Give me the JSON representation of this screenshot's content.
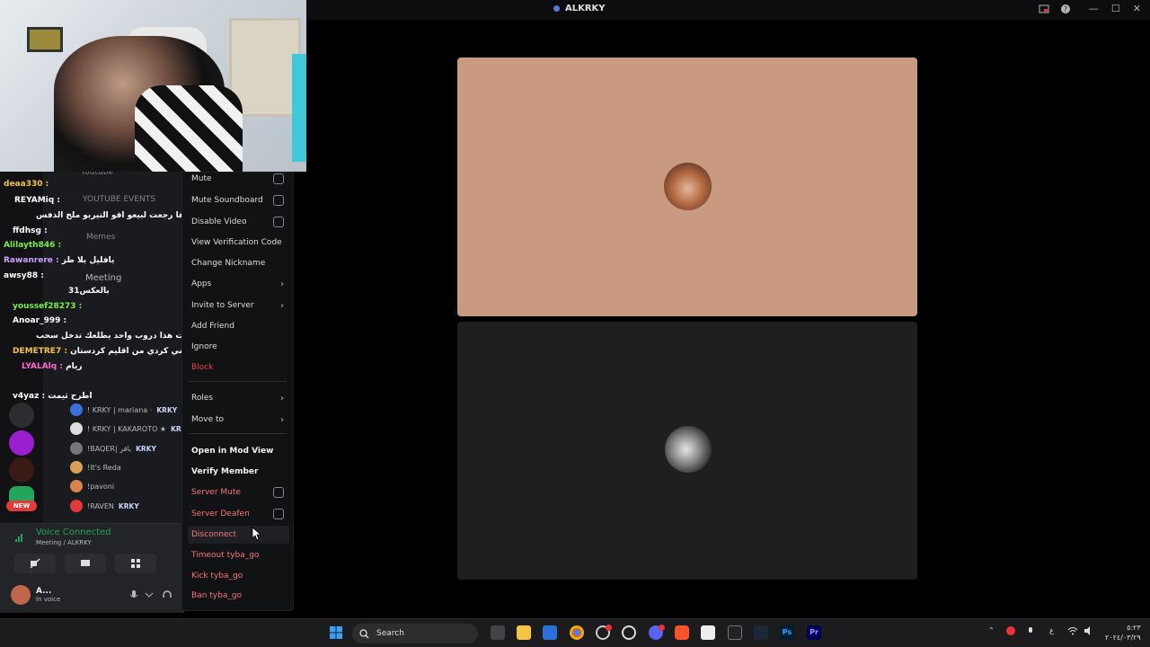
{
  "window": {
    "title": "ALKRKY"
  },
  "chat_overlay": [
    {
      "user": "deaa330 :",
      "color": "#f5c542",
      "msg": ""
    },
    {
      "user": "REYAMiq :",
      "color": "#ffffff",
      "msg": ""
    },
    {
      "user": "",
      "color": "#ffffff",
      "msg": "ها رجعت لبيعو اقو التيربو ملخ الذفس"
    },
    {
      "user": "ffdhsg :",
      "color": "#ffffff",
      "msg": ""
    },
    {
      "user": "Alilayth846 :",
      "color": "#7bed45",
      "msg": ""
    },
    {
      "user": "Rawanrere :",
      "color": "#c9a4ff",
      "msg": "يافليل يلا طز"
    },
    {
      "user": "awsy88 :",
      "color": "#ffffff",
      "msg": ""
    },
    {
      "user": "",
      "color": "#ffffff",
      "msg": "بالعكس31"
    },
    {
      "user": "youssef28273 :",
      "color": "#7bed45",
      "msg": ""
    },
    {
      "user": "Anoar_999 :",
      "color": "#ffffff",
      "msg": ""
    },
    {
      "user": "",
      "color": "#ffffff",
      "msg": "لا خمس ساعات هذا دروب واحد يطلعك تدخل سحب"
    },
    {
      "user": "DEMETRE7 :",
      "color": "#f5c542",
      "msg": "ترا اني كردي من اقليم كردستان"
    },
    {
      "user": "LYALAlq :",
      "color": "#ff6bd5",
      "msg": "ريام"
    },
    {
      "user": "",
      "color": "#ffffff",
      "msg": ""
    },
    {
      "user": "v4yaz :",
      "color": "#ffffff",
      "msg": "اطرح ثيمت"
    }
  ],
  "channels": [
    {
      "label": "Youtube"
    },
    {
      "label": "YOUTUBE EVENTS"
    },
    {
      "label": "Memes"
    },
    {
      "label": "Meeting"
    }
  ],
  "members": [
    {
      "name": "! KRKY | mariana ·",
      "tag": "KRKY",
      "color": "#3b6fd9"
    },
    {
      "name": "! KRKY | KAKAROTO ★",
      "tag": "KRI",
      "color": "#ffffff"
    },
    {
      "name": "!BAQER| باقر",
      "tag": "KRKY",
      "color": "#999999"
    },
    {
      "name": "!It's Reda",
      "tag": "",
      "color": "#d9a05b"
    },
    {
      "name": "!pavoni",
      "tag": "",
      "color": "#d98250"
    },
    {
      "name": "!RAVEN",
      "tag": "KRKY",
      "color": "#e23a3a"
    }
  ],
  "voice": {
    "status": "Voice Connected",
    "location": "Meeting / ALKRKY"
  },
  "user": {
    "name": "A...",
    "status": "In voice"
  },
  "context_menu": {
    "mute": "Mute",
    "mute_soundboard": "Mute Soundboard",
    "disable_video": "Disable Video",
    "view_verification": "View Verification Code",
    "change_nickname": "Change Nickname",
    "apps": "Apps",
    "invite": "Invite to Server",
    "add_friend": "Add Friend",
    "ignore": "Ignore",
    "block": "Block",
    "roles": "Roles",
    "move_to": "Move to",
    "mod_view": "Open in Mod View",
    "verify": "Verify Member",
    "server_mute": "Server Mute",
    "server_deafen": "Server Deafen",
    "disconnect": "Disconnect",
    "timeout": "Timeout tyba_go",
    "kick": "Kick tyba_go",
    "ban": "Ban tyba_go"
  },
  "taskbar": {
    "search_label": "Search",
    "new_badge": "NEW",
    "clock_time": "٥:٢٣",
    "clock_date": "٢٠٢٤/٠٣/٢٩"
  },
  "colors": {
    "discord_green": "#23a55a",
    "danger": "#f23f42",
    "tile1": "#c99a80"
  }
}
